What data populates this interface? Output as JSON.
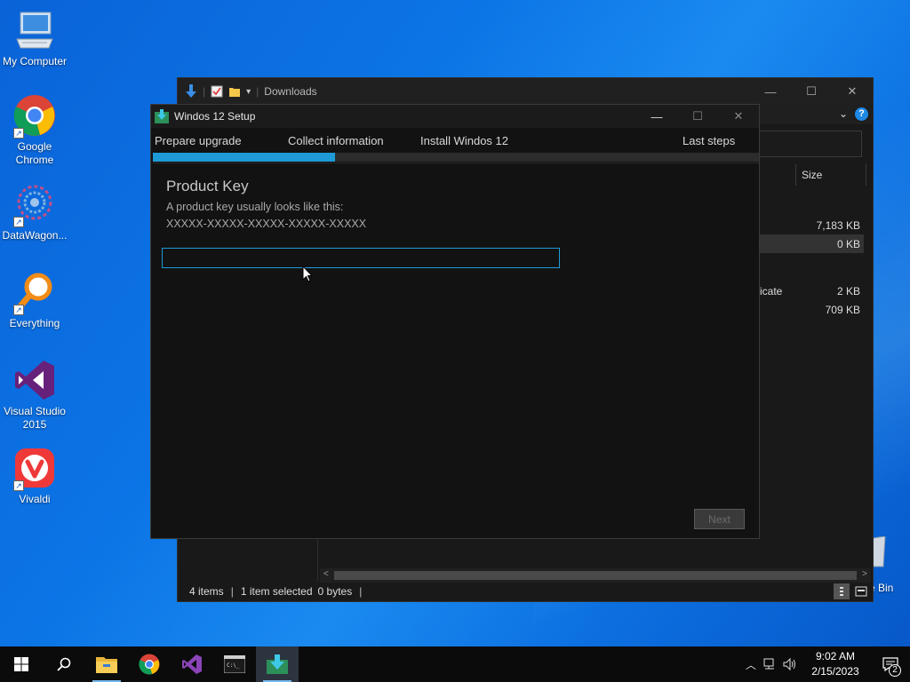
{
  "desktop": {
    "icons": [
      {
        "label": "My Computer",
        "icon": "computer-icon"
      },
      {
        "label": "Google Chrome",
        "icon": "chrome-icon"
      },
      {
        "label": "DataWagon...",
        "icon": "datawagon-icon"
      },
      {
        "label": "Everything",
        "icon": "search-magnifier-icon"
      },
      {
        "label": "Visual Studio 2015",
        "icon": "visual-studio-icon"
      },
      {
        "label": "Vivaldi",
        "icon": "vivaldi-icon"
      }
    ],
    "recycle_bin_label": "e Bin"
  },
  "explorer": {
    "title": "Downloads",
    "column_size_header": "Size",
    "rows": [
      {
        "name": "",
        "size": "7,183 KB",
        "selected": false
      },
      {
        "name": "",
        "size": "0 KB",
        "selected": true
      },
      {
        "name": "icate",
        "size": "2 KB",
        "selected": false
      },
      {
        "name": "",
        "size": "709 KB",
        "selected": false
      }
    ],
    "status": {
      "items": "4 items",
      "selected": "1 item selected",
      "bytes": "0 bytes"
    }
  },
  "setup": {
    "title": "Windos 12 Setup",
    "steps": [
      "Prepare upgrade",
      "Collect information",
      "Install Windos 12",
      "Last steps"
    ],
    "progress_fraction": 0.3,
    "heading": "Product Key",
    "subtext_line1": "A product key usually looks like this:",
    "subtext_line2": "XXXXX-XXXXX-XXXXX-XXXXX-XXXXX",
    "product_key_value": "",
    "next_label": "Next",
    "accent_color": "#1e9ad6"
  },
  "taskbar": {
    "apps": [
      "start-icon",
      "search-icon",
      "file-explorer-icon",
      "chrome-icon",
      "visual-studio-icon",
      "terminal-icon",
      "setup-installer-icon"
    ],
    "clock_time": "9:02 AM",
    "clock_date": "2/15/2023",
    "notification_count": "2"
  }
}
